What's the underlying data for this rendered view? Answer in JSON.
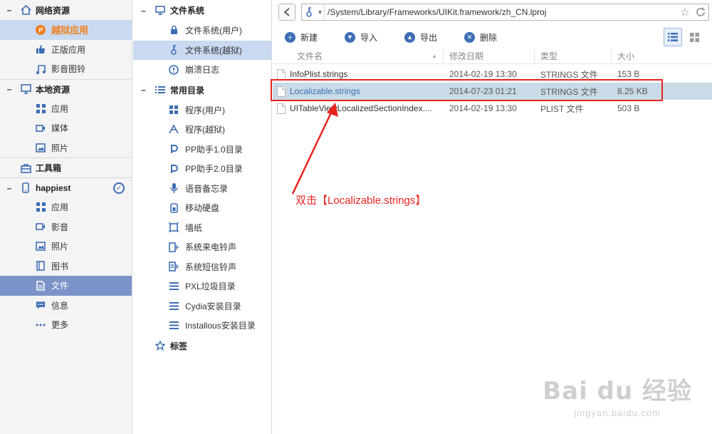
{
  "leftnav": {
    "network": {
      "title": "网络资源",
      "items": [
        {
          "label": "越狱应用",
          "icon": "pp-jailbreak-icon"
        },
        {
          "label": "正版应用",
          "icon": "thumb-icon"
        },
        {
          "label": "影音图铃",
          "icon": "music-icon"
        }
      ]
    },
    "local": {
      "title": "本地资源",
      "items": [
        {
          "label": "应用",
          "icon": "grid-icon"
        },
        {
          "label": "媒体",
          "icon": "video-icon"
        },
        {
          "label": "照片",
          "icon": "photo-icon"
        }
      ]
    },
    "toolbox": {
      "title": "工具箱"
    },
    "device": {
      "title": "happiest",
      "items": [
        {
          "label": "应用"
        },
        {
          "label": "影音"
        },
        {
          "label": "照片"
        },
        {
          "label": "图书"
        },
        {
          "label": "文件"
        },
        {
          "label": "信息"
        },
        {
          "label": "更多"
        }
      ]
    }
  },
  "tree": {
    "filesystem": {
      "title": "文件系统",
      "items": [
        {
          "label": "文件系统(用户)"
        },
        {
          "label": "文件系统(越狱)"
        },
        {
          "label": "崩溃日志"
        }
      ]
    },
    "common": {
      "title": "常用目录",
      "items": [
        {
          "label": "程序(用户)"
        },
        {
          "label": "程序(越狱)"
        },
        {
          "label": "PP助手1.0目录"
        },
        {
          "label": "PP助手2.0目录"
        },
        {
          "label": "语音备忘录"
        },
        {
          "label": "移动硬盘"
        },
        {
          "label": "墙纸"
        },
        {
          "label": "系统来电铃声"
        },
        {
          "label": "系统短信铃声"
        },
        {
          "label": "PXL垃圾目录"
        },
        {
          "label": "Cydia安装目录"
        },
        {
          "label": "Installous安装目录"
        }
      ]
    },
    "tags": {
      "title": "标签"
    }
  },
  "address": {
    "path": "/System/Library/Frameworks/UIKit.framework/zh_CN.lproj"
  },
  "toolbar": {
    "new": "新建",
    "import": "导入",
    "export": "导出",
    "delete": "删除"
  },
  "filelist": {
    "headers": {
      "name": "文件名",
      "modified": "修改日期",
      "type": "类型",
      "size": "大小"
    },
    "rows": [
      {
        "name": "InfoPlist.strings",
        "modified": "2014-02-19 13:30",
        "type": "STRINGS 文件",
        "size": "153 B"
      },
      {
        "name": "Localizable.strings",
        "modified": "2014-07-23 01:21",
        "type": "STRINGS 文件",
        "size": "8.25 KB"
      },
      {
        "name": "UITableViewLocalizedSectionIndex....",
        "modified": "2014-02-19 13:30",
        "type": "PLIST 文件",
        "size": "503 B"
      }
    ]
  },
  "annotation": {
    "text": "双击【Localizable.strings】",
    "color": "#e8241f"
  },
  "watermark": {
    "brand": "Bai du 经验",
    "url": "jingyan.baidu.com"
  },
  "colors": {
    "accent": "#3d6db5",
    "selected_nav": "#7c93c9",
    "jailbreak_orange": "#f07f1c"
  }
}
